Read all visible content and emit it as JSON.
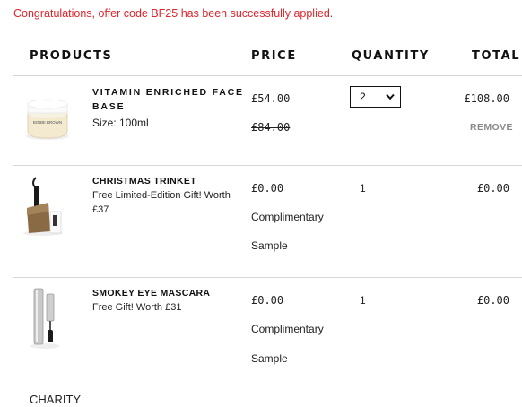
{
  "notice": "Congratulations, offer code BF25 has been successfully applied.",
  "headers": {
    "products": "PRODUCTS",
    "price": "PRICE",
    "quantity": "QUANTITY",
    "total": "TOTAL"
  },
  "items": [
    {
      "name": "VITAMIN ENRICHED FACE BASE",
      "size": "Size: 100ml",
      "price": "£54.00",
      "original_price": "£84.00",
      "quantity": "2",
      "total": "£108.00",
      "remove_label": "REMOVE",
      "image_label": "BOBBI BROWN"
    },
    {
      "name": "CHRISTMAS TRINKET",
      "description": "Free Limited-Edition Gift! Worth £37",
      "price": "£0.00",
      "note_line1": "Complimentary",
      "note_line2": "Sample",
      "quantity": "1",
      "total": "£0.00"
    },
    {
      "name": "SMOKEY EYE MASCARA",
      "description": "Free Gift! Worth £31",
      "price": "£0.00",
      "note_line1": "Complimentary",
      "note_line2": "Sample",
      "quantity": "1",
      "total": "£0.00"
    }
  ],
  "charity_heading": "CHARITY",
  "colors": {
    "notice": "#e0242b",
    "divider": "#d6d6d6",
    "remove": "#8a8a8a"
  },
  "icons": {
    "select_caret": "chevron-down-icon"
  }
}
